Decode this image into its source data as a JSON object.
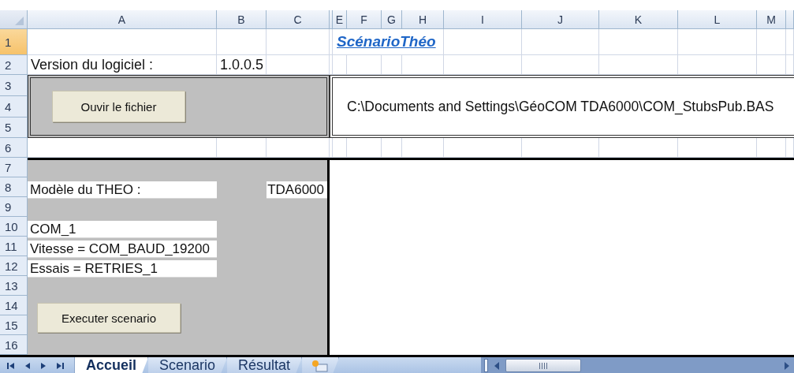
{
  "column_headers": [
    {
      "kind": "letter",
      "label": "A"
    },
    {
      "kind": "letter",
      "label": "B"
    },
    {
      "kind": "letter",
      "label": "C"
    },
    {
      "kind": "blank"
    },
    {
      "kind": "letter",
      "label": "E"
    },
    {
      "kind": "letter",
      "label": "F"
    },
    {
      "kind": "letter",
      "label": "G"
    },
    {
      "kind": "letter",
      "label": "H"
    },
    {
      "kind": "letter",
      "label": "I"
    },
    {
      "kind": "letter",
      "label": "J"
    },
    {
      "kind": "letter",
      "label": "K"
    },
    {
      "kind": "letter",
      "label": "L"
    },
    {
      "kind": "letter",
      "label": "M"
    },
    {
      "kind": "blank"
    }
  ],
  "row_headers": [
    {
      "label": "1",
      "selected": true
    },
    {
      "label": "2",
      "selected": false
    },
    {
      "label": "3",
      "selected": false
    },
    {
      "label": "4",
      "selected": false
    },
    {
      "label": "5",
      "selected": false
    },
    {
      "label": "6",
      "selected": false
    },
    {
      "label": "7",
      "selected": false
    },
    {
      "label": "8",
      "selected": false
    },
    {
      "label": "9",
      "selected": false
    },
    {
      "label": "10",
      "selected": false
    },
    {
      "label": "11",
      "selected": false
    },
    {
      "label": "12",
      "selected": false
    },
    {
      "label": "13",
      "selected": false
    },
    {
      "label": "14",
      "selected": false
    },
    {
      "label": "15",
      "selected": false
    },
    {
      "label": "16",
      "selected": false
    }
  ],
  "title": "ScénarioThéo",
  "version": {
    "label": "Version du logiciel :",
    "value": "1.0.0.5"
  },
  "file_panel": {
    "button": "Ouvir le fichier",
    "path": "C:\\Documents and Settings\\GéoCOM TDA6000\\COM_StubsPub.BAS"
  },
  "settings_panel": {
    "model_label": "Modèle du THEO :",
    "model_value": "TDA6000",
    "lines": [
      "COM_1",
      "Vitesse = COM_BAUD_19200",
      "Essais = RETRIES_1"
    ],
    "button": "Executer scenario"
  },
  "sheet_tabs": [
    {
      "label": "Accueil",
      "selected": true
    },
    {
      "label": "Scenario",
      "selected": false
    },
    {
      "label": "Résultat",
      "selected": false
    }
  ]
}
